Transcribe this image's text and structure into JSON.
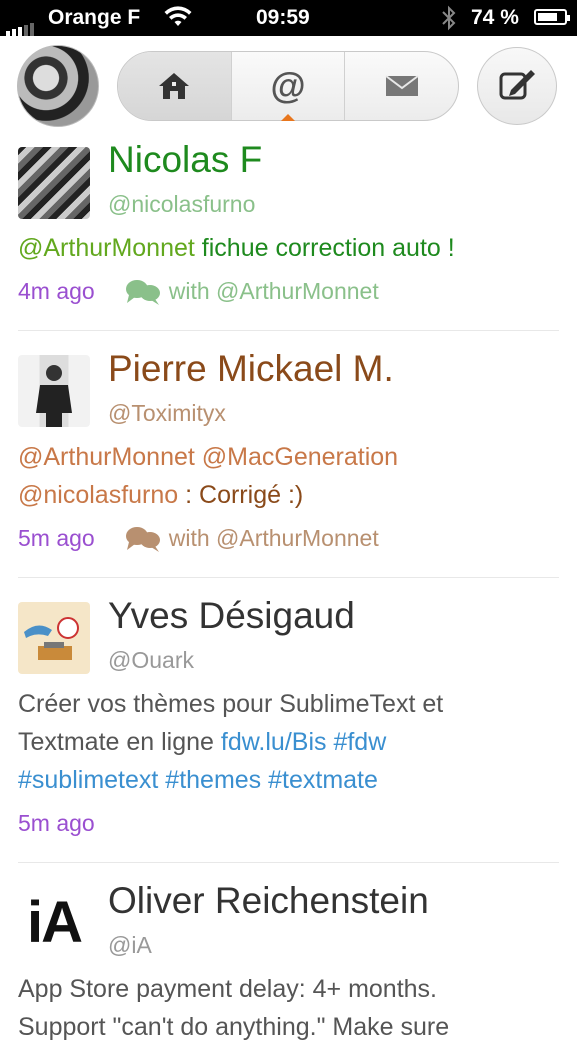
{
  "status_bar": {
    "carrier": "Orange F",
    "time": "09:59",
    "battery_pct": "74 %",
    "battery_level": 0.74
  },
  "tabs": [
    {
      "name": "home"
    },
    {
      "name": "mentions",
      "indicator": true
    },
    {
      "name": "messages"
    }
  ],
  "tweets": [
    {
      "name": "Nicolas F",
      "handle": "@nicolasfurno",
      "text": [
        {
          "t": "@ArthurMonnet",
          "kind": "mention"
        },
        {
          "t": " fichue correction auto !",
          "kind": "plain"
        }
      ],
      "time": "4m ago",
      "conversation": "with @ArthurMonnet",
      "colors": {
        "name": "#1e8a1e",
        "handle": "#8ac08a",
        "plain": "#1e8a1e",
        "mention": "#62a81e",
        "meta": "#8ac08a"
      }
    },
    {
      "name": "Pierre Mickael M.",
      "handle": "@Toximityx",
      "text": [
        {
          "t": "@ArthurMonnet @MacGeneration",
          "kind": "mention"
        },
        {
          "t": "\n",
          "kind": "break"
        },
        {
          "t": "@nicolasfurno",
          "kind": "mention"
        },
        {
          "t": " : Corrigé :)",
          "kind": "plain"
        }
      ],
      "time": "5m ago",
      "conversation": "with @ArthurMonnet",
      "colors": {
        "name": "#8a4a1a",
        "handle": "#b89070",
        "plain": "#8a4a1a",
        "mention": "#c87848",
        "meta": "#b89070"
      }
    },
    {
      "name": "Yves Désigaud",
      "handle": "@Ouark",
      "text": [
        {
          "t": "Créer vos thèmes pour SublimeText et",
          "kind": "plain"
        },
        {
          "t": "\n",
          "kind": "break"
        },
        {
          "t": "Textmate en ligne ",
          "kind": "plain"
        },
        {
          "t": "fdw.lu/Bis #fdw",
          "kind": "link"
        },
        {
          "t": "\n",
          "kind": "break"
        },
        {
          "t": "#sublimetext #themes #textmate",
          "kind": "link"
        }
      ],
      "time": "5m ago",
      "conversation": "",
      "colors": {
        "name": "#333333",
        "handle": "#999999",
        "plain": "#555555",
        "link": "#3a8fd0",
        "meta": "#999999"
      }
    },
    {
      "name": "Oliver Reichenstein",
      "handle": "@iA",
      "avatar_text": "iA",
      "text": [
        {
          "t": "App Store payment delay: 4+ months.",
          "kind": "plain"
        },
        {
          "t": "\n",
          "kind": "break"
        },
        {
          "t": "Support \"can't do anything.\" Make sure",
          "kind": "plain"
        }
      ],
      "time": "",
      "conversation": "",
      "colors": {
        "name": "#333333",
        "handle": "#999999",
        "plain": "#555555",
        "meta": "#999999"
      }
    }
  ]
}
